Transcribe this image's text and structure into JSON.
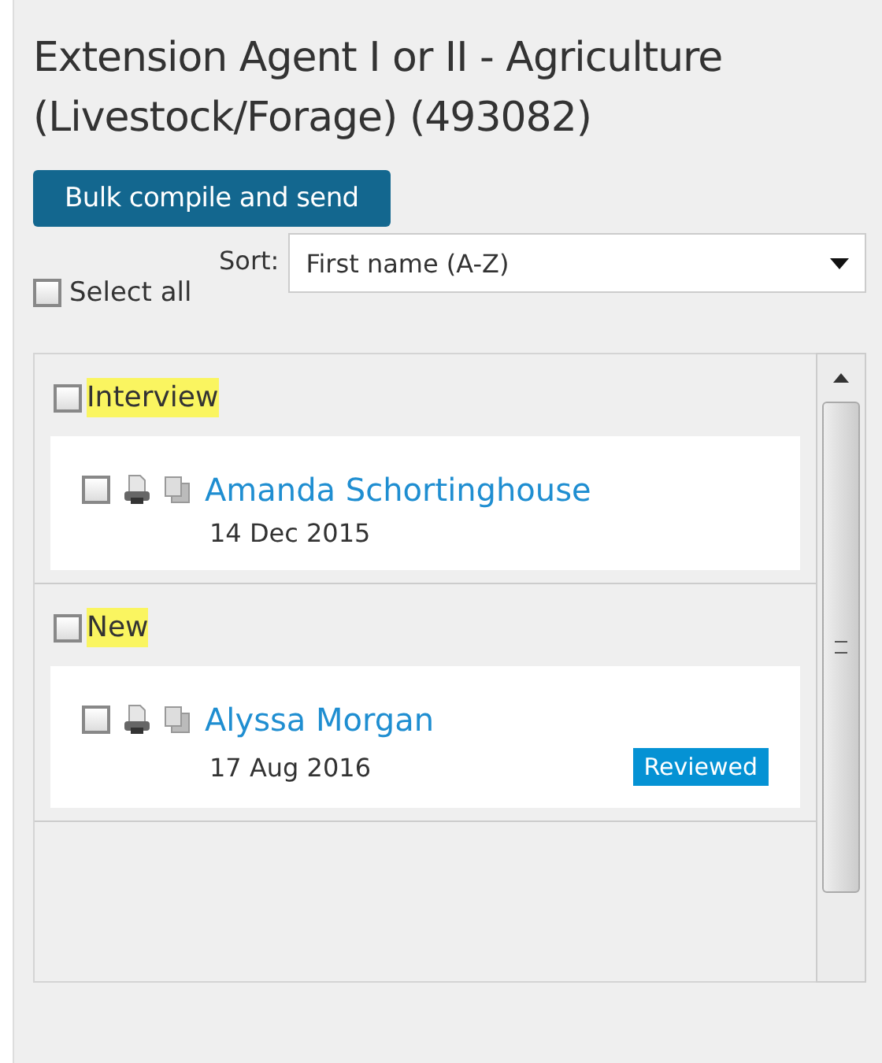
{
  "title": "Extension Agent I or II - Agriculture (Livestock/Forage) (493082)",
  "bulk_button": "Bulk compile and send",
  "select_all": {
    "label": "Select all",
    "checked": false
  },
  "sort": {
    "label": "Sort:",
    "value": "First name (A-Z)"
  },
  "groups": [
    {
      "label": "Interview",
      "highlighted": true,
      "checked": false,
      "candidates": [
        {
          "first": "Amanda",
          "last": "Schortinghouse",
          "date": "14 Dec 2015",
          "checked": false
        }
      ]
    },
    {
      "label": "New",
      "highlighted": true,
      "checked": false,
      "candidates": [
        {
          "first": "Alyssa",
          "last": "Morgan",
          "date": "17 Aug 2016",
          "checked": false,
          "badge": "Reviewed"
        }
      ]
    }
  ]
}
